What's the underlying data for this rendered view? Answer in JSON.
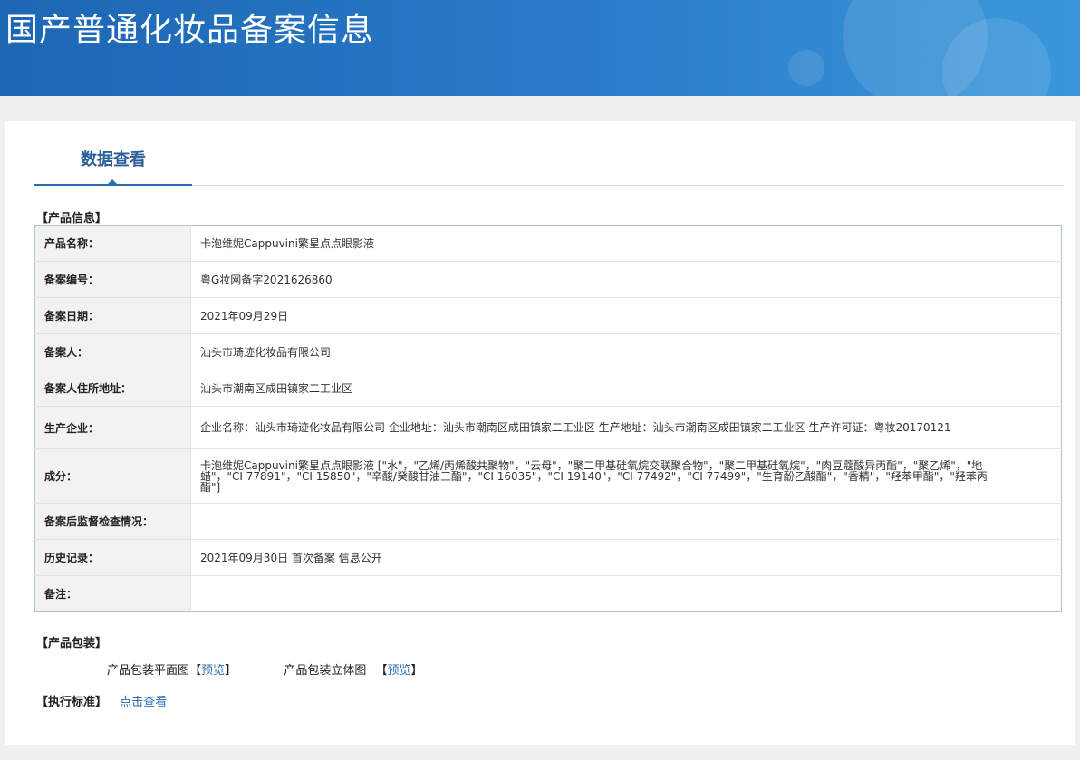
{
  "banner": {
    "title": "国产普通化妆品备案信息"
  },
  "tab": {
    "label": "数据查看"
  },
  "product_info": {
    "section_title": "【产品信息】",
    "rows": [
      {
        "label": "产品名称：",
        "value": "卡泡维妮Cappuvini繁星点点眼影液"
      },
      {
        "label": "备案编号：",
        "value": "粤G妆网备字2021626860"
      },
      {
        "label": "备案日期：",
        "value": "2021年09月29日"
      },
      {
        "label": "备案人：",
        "value": "汕头市琦迹化妆品有限公司"
      },
      {
        "label": "备案人住所地址：",
        "value": "汕头市潮南区成田镇家二工业区"
      },
      {
        "label": "生产企业：",
        "value": "企业名称：汕头市琦迹化妆品有限公司 企业地址：汕头市潮南区成田镇家二工业区 生产地址：汕头市潮南区成田镇家二工业区 生产许可证：粤妆20170121"
      },
      {
        "label": "成分：",
        "value": "卡泡维妮Cappuvini繁星点点眼影液 [\"水\"，\"乙烯/丙烯酸共聚物\"，\"云母\"，\"聚二甲基硅氧烷交联聚合物\"，\"聚二甲基硅氧烷\"，\"肉豆蔻酸异丙酯\"，\"聚乙烯\"，\"地蜡\"，\"CI 77891\"，\"CI 15850\"，\"辛酸/癸酸甘油三酯\"，\"CI 16035\"，\"CI 19140\"，\"CI 77492\"，\"CI 77499\"，\"生育酚乙酸酯\"，\"香精\"，\"羟苯甲酯\"，\"羟苯丙酯\"]"
      },
      {
        "label": "备案后监督检查情况：",
        "value": ""
      },
      {
        "label": "历史记录：",
        "value": "2021年09月30日 首次备案 信息公开"
      },
      {
        "label": "备注：",
        "value": ""
      }
    ]
  },
  "packaging": {
    "section_title": "【产品包装】",
    "flat_label": "产品包装平面图",
    "solid_label": "产品包装立体图",
    "bracket_open": "【",
    "bracket_close": "】",
    "preview_link": "预览"
  },
  "standard": {
    "section_title": "【执行标准】",
    "link": "点击查看"
  }
}
